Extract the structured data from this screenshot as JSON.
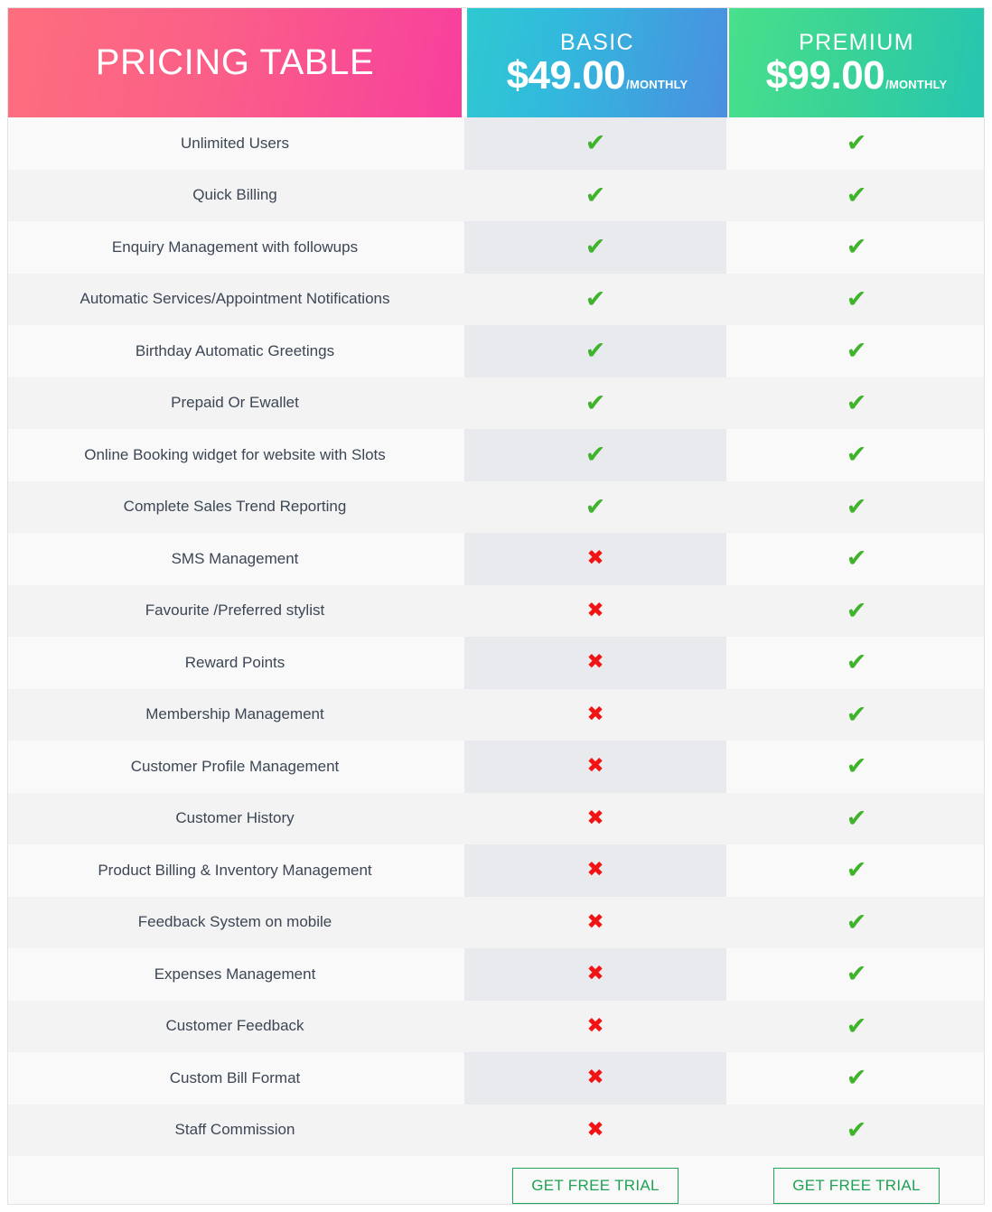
{
  "table": {
    "title": "PRICING TABLE",
    "currency_symbol": "$",
    "check_glyph": "✔",
    "cross_glyph": "✖",
    "colors": {
      "title_gradient_start": "#fd6e7e",
      "title_gradient_end": "#f73f9d",
      "basic_gradient_start": "#2ec9d0",
      "basic_gradient_end": "#4a8fe0",
      "premium_gradient_start": "#48e08b",
      "premium_gradient_end": "#26c5b1",
      "check_color": "#3fb32b",
      "cross_color": "#f01414",
      "cta_border": "#24a65a",
      "cta_text": "#1fa055",
      "row_odd": "#f9f9f9",
      "row_even": "#f3f3f3",
      "basic_highlight": "#e9eaee"
    }
  },
  "plans": [
    {
      "name": "BASIC",
      "price": "$49.00",
      "period": "/MONTHLY",
      "cta_label": "GET FREE TRIAL"
    },
    {
      "name": "PREMIUM",
      "price": "$99.00",
      "period": "/MONTHLY",
      "cta_label": "GET FREE TRIAL"
    }
  ],
  "features": [
    {
      "label": "Unlimited Users",
      "basic": "✔",
      "premium": "✔"
    },
    {
      "label": "Quick Billing",
      "basic": "✔",
      "premium": "✔"
    },
    {
      "label": "Enquiry Management with followups",
      "basic": "✔",
      "premium": "✔"
    },
    {
      "label": "Automatic Services/Appointment Notifications",
      "basic": "✔",
      "premium": "✔"
    },
    {
      "label": "Birthday Automatic Greetings",
      "basic": "✔",
      "premium": "✔"
    },
    {
      "label": "Prepaid Or Ewallet",
      "basic": "✔",
      "premium": "✔"
    },
    {
      "label": "Online Booking widget for website with Slots",
      "basic": "✔",
      "premium": "✔"
    },
    {
      "label": "Complete Sales Trend Reporting",
      "basic": "✔",
      "premium": "✔"
    },
    {
      "label": "SMS Management",
      "basic": "✖",
      "premium": "✔"
    },
    {
      "label": "Favourite /Preferred stylist",
      "basic": "✖",
      "premium": "✔"
    },
    {
      "label": "Reward Points",
      "basic": "✖",
      "premium": "✔"
    },
    {
      "label": "Membership Management",
      "basic": "✖",
      "premium": "✔"
    },
    {
      "label": "Customer Profile Management",
      "basic": "✖",
      "premium": "✔"
    },
    {
      "label": "Customer History",
      "basic": "✖",
      "premium": "✔"
    },
    {
      "label": "Product Billing & Inventory Management",
      "basic": "✖",
      "premium": "✔"
    },
    {
      "label": "Feedback System on mobile",
      "basic": "✖",
      "premium": "✔"
    },
    {
      "label": "Expenses Management",
      "basic": "✖",
      "premium": "✔"
    },
    {
      "label": "Customer Feedback",
      "basic": "✖",
      "premium": "✔"
    },
    {
      "label": "Custom Bill Format",
      "basic": "✖",
      "premium": "✔"
    },
    {
      "label": "Staff Commission",
      "basic": "✖",
      "premium": "✔"
    }
  ]
}
